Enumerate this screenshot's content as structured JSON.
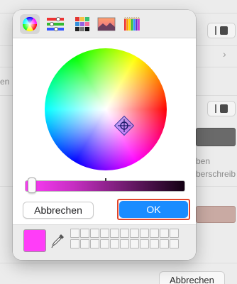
{
  "background": {
    "texts": {
      "en": "en",
      "ben": "ben",
      "uberschreib": "berschreib"
    },
    "cancel_button": "Abbrechen",
    "colors": {
      "gray_swatch": "#6a6a6a",
      "rose_swatch": "#c9aaa3"
    }
  },
  "color_panel": {
    "toolbar": [
      {
        "name": "color-wheel-tab",
        "icon": "color-wheel-icon",
        "selected": true
      },
      {
        "name": "color-sliders-tab",
        "icon": "sliders-icon",
        "selected": false
      },
      {
        "name": "color-palettes-tab",
        "icon": "palette-icon",
        "selected": false
      },
      {
        "name": "image-palettes-tab",
        "icon": "image-icon",
        "selected": false
      },
      {
        "name": "pencils-tab",
        "icon": "pencils-icon",
        "selected": false
      }
    ],
    "cancel_label": "Abbrechen",
    "ok_label": "OK",
    "current_color": "#ff3df8",
    "ok_color": "#1a8cff",
    "highlight_color": "#e0452c",
    "brightness_slider_label": "brightness",
    "favorite_swatch_count": 22
  }
}
